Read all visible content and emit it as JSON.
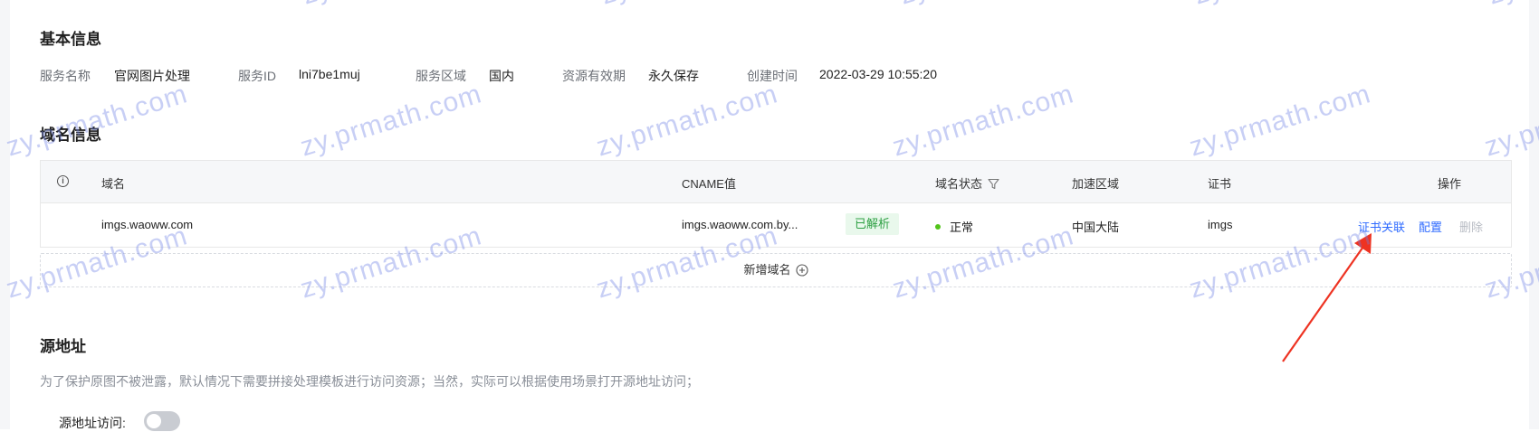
{
  "basic_info": {
    "title": "基本信息",
    "service_name_label": "服务名称",
    "service_name_value": "官网图片处理",
    "service_id_label": "服务ID",
    "service_id_value": "lni7be1muj",
    "region_label": "服务区域",
    "region_value": "国内",
    "validity_label": "资源有效期",
    "validity_value": "永久保存",
    "created_label": "创建时间",
    "created_value": "2022-03-29 10:55:20"
  },
  "domain_info": {
    "title": "域名信息",
    "columns": {
      "domain": "域名",
      "cname": "CNAME值",
      "status": "域名状态",
      "accel_region": "加速区域",
      "cert": "证书",
      "ops": "操作"
    },
    "row": {
      "domain": "imgs.waoww.com",
      "cname": "imgs.waoww.com.by...",
      "cname_badge": "已解析",
      "status": "正常",
      "accel_region": "中国大陆",
      "cert": "imgs",
      "op_cert": "证书关联",
      "op_config": "配置",
      "op_delete": "删除"
    },
    "add_domain": "新增域名"
  },
  "origin": {
    "title": "源地址",
    "hint": "为了保护原图不被泄露，默认情况下需要拼接处理模板进行访问资源；当然，实际可以根据使用场景打开源地址访问；",
    "toggle_label": "源地址访问:",
    "toggle_on": false
  },
  "watermark": "zy.prmath.com",
  "colors": {
    "link": "#2f6bff",
    "success": "#2ea043",
    "status_dot": "#52c41a",
    "arrow": "#ee3322"
  }
}
